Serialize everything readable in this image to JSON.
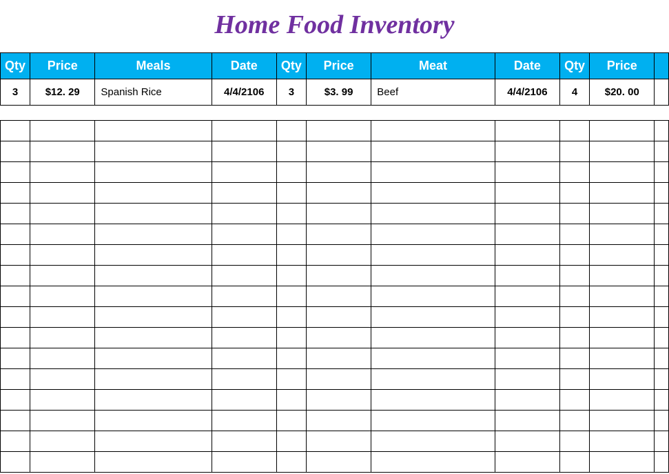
{
  "title": "Home Food Inventory",
  "headers": {
    "qty1": "Qty",
    "price1": "Price",
    "meals": "Meals",
    "date1": "Date",
    "qty2": "Qty",
    "price2": "Price",
    "meat": "Meat",
    "date2": "Date",
    "qty3": "Qty",
    "price3": "Price",
    "extra": ""
  },
  "row": {
    "qty1": "3",
    "price1": "$12. 29",
    "meals": "Spanish Rice",
    "date1": "4/4/2106",
    "qty2": "3",
    "price2": "$3. 99",
    "meat": "Beef",
    "date2": "4/4/2106",
    "qty3": "4",
    "price3": "$20. 00",
    "extra": ""
  },
  "emptyRowCount": 17
}
